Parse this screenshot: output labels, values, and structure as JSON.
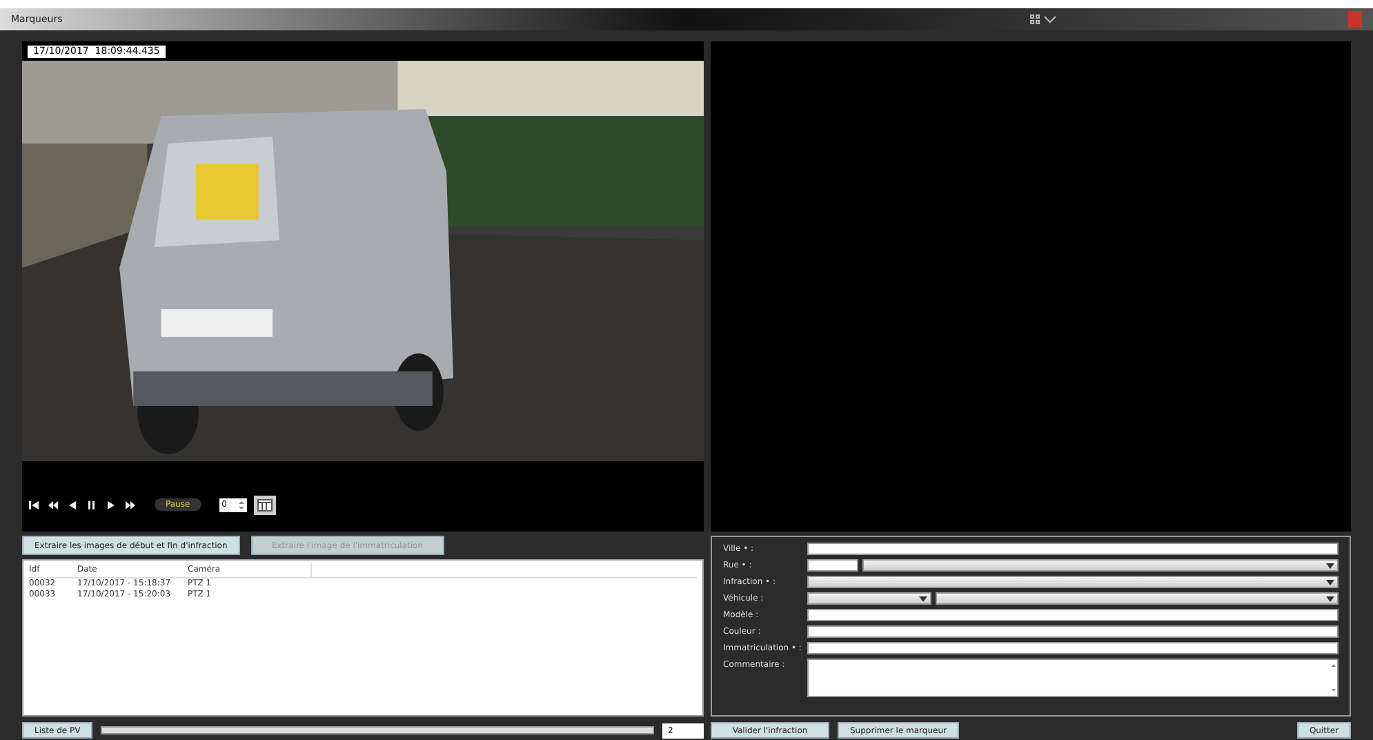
{
  "window": {
    "title": "Marqueurs"
  },
  "video": {
    "timestamp": "17/10/2017  18:09:44.435",
    "kind": "picture"
  },
  "player": {
    "status": "Pause",
    "frame": "0"
  },
  "actions": [
    {
      "label": "Extraire les images de début et fin d'infraction",
      "disabled": false
    },
    {
      "label": "Extraire l'image de l'immatriculation",
      "disabled": true
    }
  ],
  "table": {
    "columns": [
      "Idf",
      "Date",
      "Caméra"
    ],
    "rows": [
      [
        "00032",
        "17/10/2017 - 15:18:37",
        "PTZ 1"
      ],
      [
        "00033",
        "17/10/2017 - 15:20:03",
        "PTZ 1"
      ]
    ]
  },
  "form": {
    "fields": [
      {
        "label": "Ville • :",
        "kind": "text"
      },
      {
        "label": "Rue • :",
        "kind": "text_select"
      },
      {
        "label": "Infraction • :",
        "kind": "select"
      },
      {
        "label": "Véhicule :",
        "kind": "select_pair"
      },
      {
        "label": "Modèle :",
        "kind": "text"
      },
      {
        "label": "Couleur :",
        "kind": "text"
      },
      {
        "label": "Immatriculation • :",
        "kind": "text"
      },
      {
        "label": "Commentaire :",
        "kind": "textarea"
      }
    ]
  },
  "footer": {
    "list_button": "Liste de PV",
    "page": "2",
    "validate_button": "Valider l'infraction",
    "delete_button": "Supprimer le marqueur",
    "quit_button": "Quitter"
  }
}
